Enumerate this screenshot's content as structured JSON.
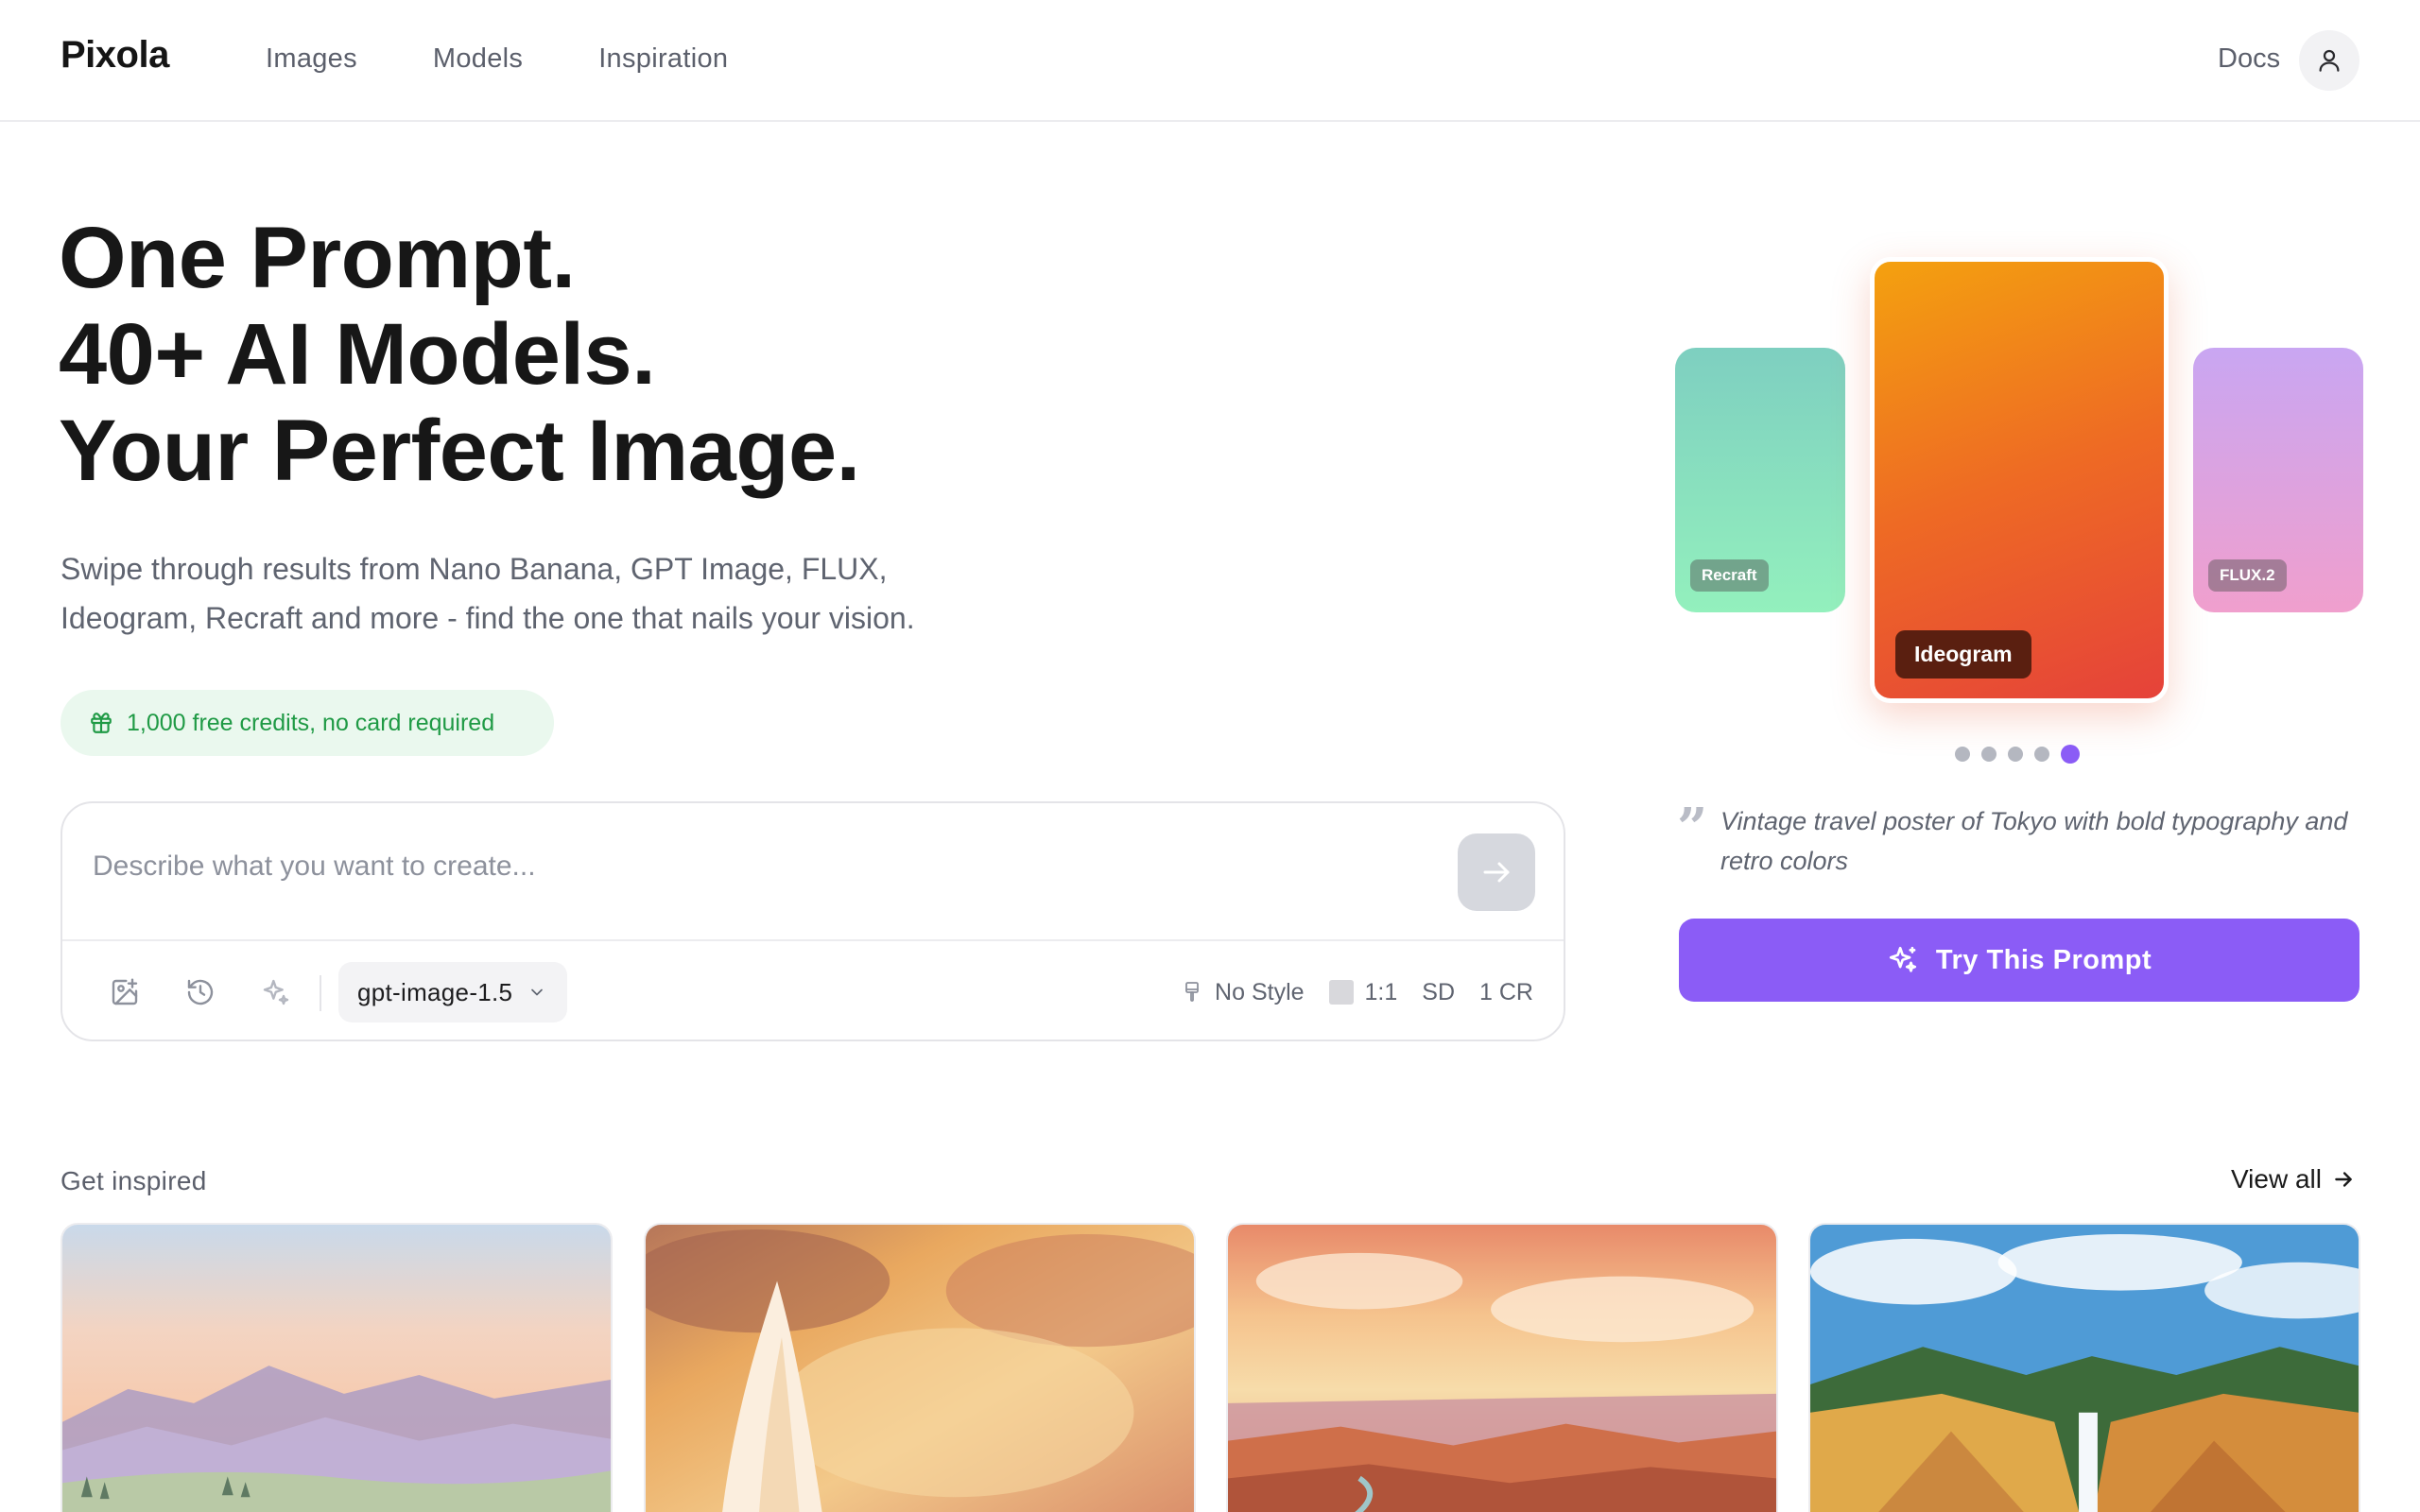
{
  "header": {
    "logo": "Pixola",
    "nav": [
      {
        "label": "Images"
      },
      {
        "label": "Models"
      },
      {
        "label": "Inspiration"
      }
    ],
    "docs_label": "Docs",
    "avatar_icon": "user-icon"
  },
  "hero": {
    "title_lines": [
      "One Prompt.",
      "40+ AI Models.",
      "Your Perfect Image."
    ],
    "subtitle_lines": [
      "Swipe through results from Nano Banana, GPT Image, FLUX,",
      "Ideogram, Recraft and more - find the one that nails your vision."
    ],
    "credits_badge": "1,000 free credits, no card required"
  },
  "prompt": {
    "placeholder": "Describe what you want to create...",
    "send_icon": "arrow-right-icon",
    "tools": [
      "image-upload-icon",
      "history-icon",
      "sparkle-icon"
    ],
    "model": "gpt-image-1.5",
    "style": "No Style",
    "aspect_ratio": "1:1",
    "quality": "SD",
    "cost": "1 CR"
  },
  "carousel": {
    "cards": [
      {
        "label": "Recraft"
      },
      {
        "label": "Ideogram"
      },
      {
        "label": "FLUX.2"
      }
    ],
    "dot_count": 5,
    "active_dot": 5,
    "prompt_quote": "Vintage travel poster of Tokyo with bold typography and retro colors",
    "try_button": "Try This Prompt",
    "accent": "#8b5cf6"
  },
  "inspired": {
    "label": "Get inspired",
    "view_all": "View all",
    "thumbnails": [
      {
        "name": "watercolor-meadow-mountains"
      },
      {
        "name": "watercolor-geyser"
      },
      {
        "name": "watercolor-canyon-sunset"
      },
      {
        "name": "watercolor-waterfall-canyon"
      }
    ]
  },
  "colors": {
    "credits_green": "#1f9a45",
    "credits_bg": "#eaf8ee",
    "text_muted": "#5f6470"
  }
}
